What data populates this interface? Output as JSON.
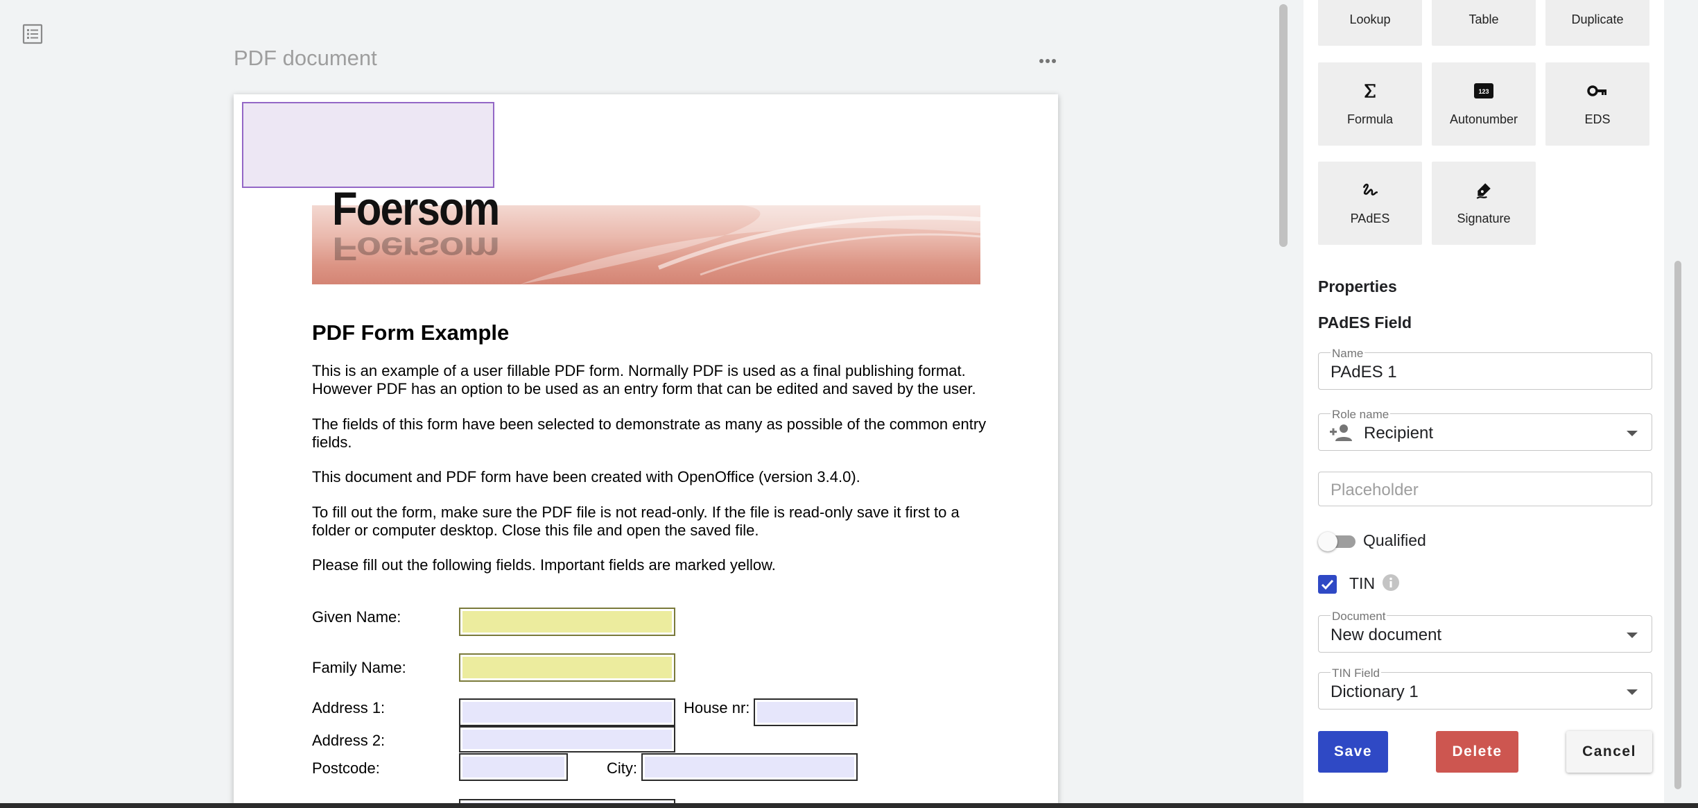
{
  "document": {
    "title": "PDF document",
    "list_icon": "list-icon",
    "more_icon": "more-horizontal-icon"
  },
  "pdf": {
    "logo_text": "Foersom",
    "form_title": "PDF Form Example",
    "paragraphs": [
      "This is an example of a user fillable PDF form. Normally PDF is used as a final publishing format. However PDF has an option to be used as an entry form that can be edited and saved by the user.",
      "The fields of this form have been selected to demonstrate as many as possible of the common entry fields.",
      "This document and PDF form have been created with OpenOffice (version 3.4.0).",
      "To fill out the form, make sure the PDF file is not read-only. If the file is read-only save it first to a folder or computer desktop. Close this file and open the saved file.",
      "Please fill out the following fields. Important fields are marked yellow."
    ],
    "labels": {
      "given_name": "Given Name:",
      "family_name": "Family Name:",
      "address1": "Address 1:",
      "house_nr": "House nr:",
      "address2": "Address 2:",
      "postcode": "Postcode:",
      "city": "City:"
    },
    "important_field_color": "#ecec9e",
    "optional_field_color": "#e6e6fb",
    "placed_field_color": "#ede7f4"
  },
  "palette": {
    "tiles": [
      {
        "label": "Lookup",
        "icon": ""
      },
      {
        "label": "Table",
        "icon": ""
      },
      {
        "label": "Duplicate",
        "icon": ""
      },
      {
        "label": "Formula",
        "icon": "sigma-icon"
      },
      {
        "label": "Autonumber",
        "icon": "number-123-icon"
      },
      {
        "label": "EDS",
        "icon": "key-icon"
      },
      {
        "label": "PAdES",
        "icon": "signature-scribble-icon"
      },
      {
        "label": "Signature",
        "icon": "pen-sign-icon"
      }
    ]
  },
  "properties": {
    "heading": "Properties",
    "field_type": "PAdES Field",
    "name_label": "Name",
    "name_value": "PAdES 1",
    "role_label": "Role name",
    "role_value": "Recipient",
    "placeholder": "Placeholder",
    "qualified_label": "Qualified",
    "qualified_on": false,
    "tin_label": "TIN",
    "tin_checked": true,
    "document_label": "Document",
    "document_value": "New document",
    "tin_field_label": "TIN Field",
    "tin_field_value": "Dictionary 1"
  },
  "actions": {
    "save": "Save",
    "delete": "Delete",
    "cancel": "Cancel"
  },
  "colors": {
    "primary": "#2f49c5",
    "danger": "#cd5650"
  }
}
